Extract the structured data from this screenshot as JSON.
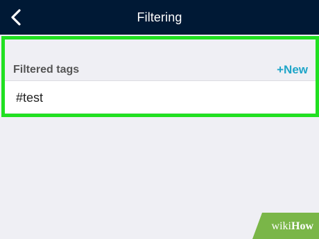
{
  "nav": {
    "title": "Filtering",
    "back_icon": "chevron-left-icon"
  },
  "section": {
    "title": "Filtered tags",
    "new_label": "+New"
  },
  "tags": [
    "#test"
  ],
  "watermark": {
    "wiki": "wiki",
    "how": "How"
  },
  "colors": {
    "nav_bg": "#001935",
    "page_bg": "#efeff4",
    "accent": "#1fa5c8",
    "highlight": "#21e021",
    "watermark_green": "#7ab648"
  }
}
